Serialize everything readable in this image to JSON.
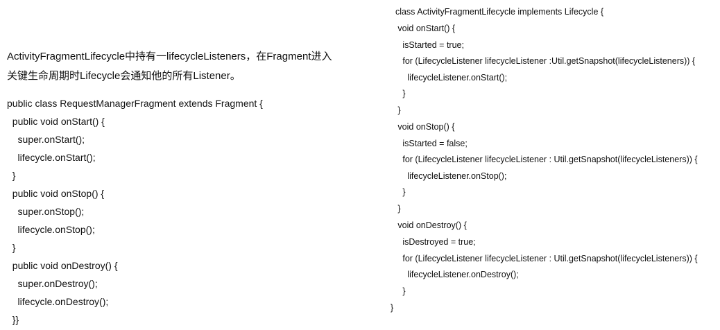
{
  "intro": {
    "line1": "ActivityFragmentLifecycle中持有一lifecycleListeners，在Fragment进入",
    "line2": "关键生命周期时Lifecycle会通知他的所有Listener。"
  },
  "left_code": [
    "public class RequestManagerFragment extends Fragment {",
    "  public void onStart() {",
    "    super.onStart();",
    "    lifecycle.onStart();",
    "  }",
    "  public void onStop() {",
    "    super.onStop();",
    "    lifecycle.onStop();",
    "  }",
    "  public void onDestroy() {",
    "    super.onDestroy();",
    "    lifecycle.onDestroy();",
    "  }}"
  ],
  "right_code": [
    "  class ActivityFragmentLifecycle implements Lifecycle {",
    "   void onStart() {",
    "     isStarted = true;",
    "     for (LifecycleListener lifecycleListener :Util.getSnapshot(lifecycleListeners)) {",
    "       lifecycleListener.onStart();",
    "     }",
    "   }",
    "   void onStop() {",
    "     isStarted = false;",
    "     for (LifecycleListener lifecycleListener : Util.getSnapshot(lifecycleListeners)) {",
    "       lifecycleListener.onStop();",
    "     }",
    "   }",
    "   void onDestroy() {",
    "     isDestroyed = true;",
    "     for (LifecycleListener lifecycleListener : Util.getSnapshot(lifecycleListeners)) {",
    "       lifecycleListener.onDestroy();",
    "     }",
    "}"
  ]
}
